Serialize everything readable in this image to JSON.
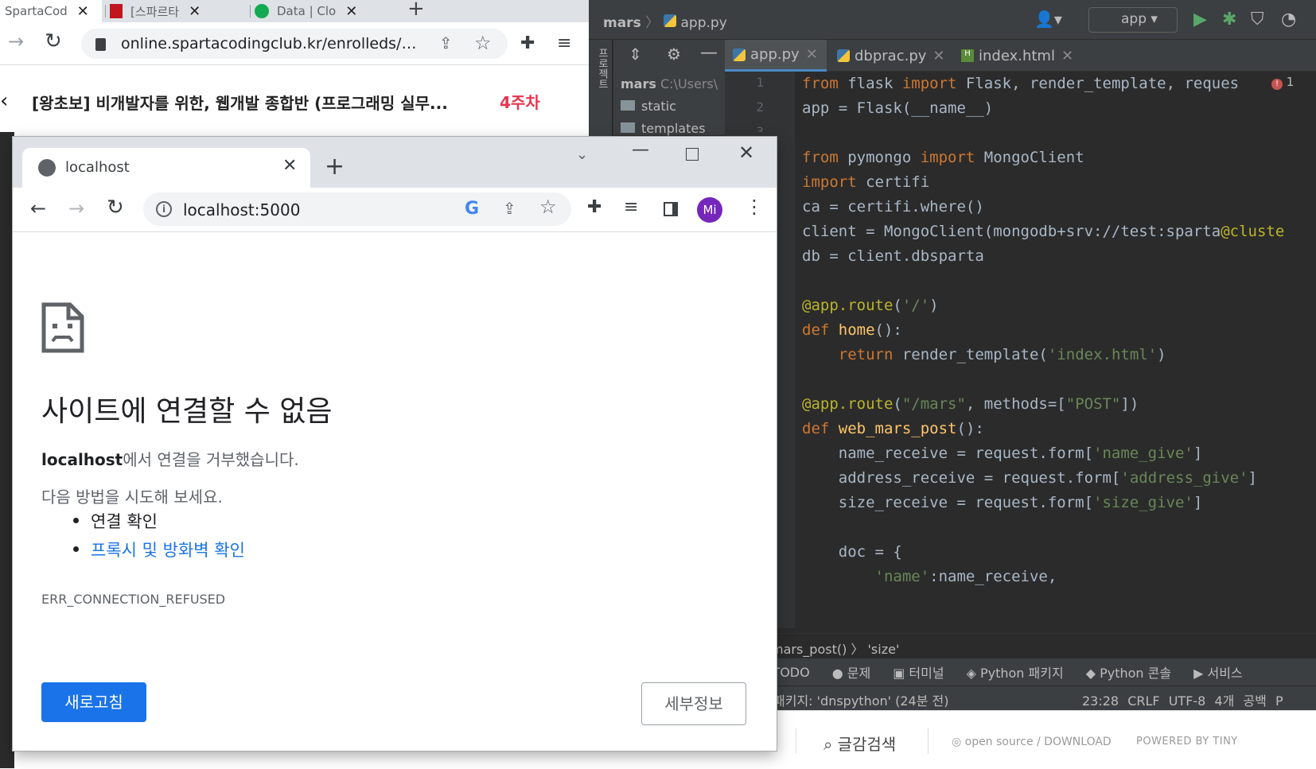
{
  "back_browser": {
    "tabs": [
      {
        "label": "SpartaCod"
      },
      {
        "label": "[스파르타"
      },
      {
        "label": "Data | Clo"
      }
    ],
    "url": "online.spartacodingclub.kr/enrolleds/6...",
    "page_title": "[왕초보] 비개발자를 위한, 웹개발 종합반 (프로그래밍 실무...",
    "week_badge": "4주차",
    "new_tab": "+"
  },
  "ide": {
    "breadcrumb_project": "mars",
    "breadcrumb_file": "app.py",
    "run_config": "app",
    "side_label": "프로젝트",
    "project": {
      "root": "mars",
      "root_path": "C:\\Users\\",
      "folders": [
        "static",
        "templates"
      ]
    },
    "tabs": [
      {
        "label": "app.py"
      },
      {
        "label": "dbprac.py"
      },
      {
        "label": "index.html"
      }
    ],
    "error_count": "1",
    "line_numbers": [
      "1",
      "2",
      "3"
    ],
    "code_lines": [
      "from flask import Flask, render_template, reques",
      "app = Flask(__name__)",
      "",
      "from pymongo import MongoClient",
      "import certifi",
      "ca = certifi.where()",
      "client = MongoClient('mongodb+srv://test:sparta@cluste",
      "db = client.dbsparta",
      "",
      "@app.route('/')",
      "def home():",
      "    return render_template('index.html')",
      "",
      "@app.route(\"/mars\", methods=[\"POST\"])",
      "def web_mars_post():",
      "    name_receive = request.form['name_give']",
      "    address_receive = request.form['address_give']",
      "    size_receive = request.form['size_give']",
      "",
      "    doc = {",
      "        'name':name_receive,"
    ],
    "editor_breadcrumb": "mars_post()  〉 'size'",
    "tool_windows": [
      "TODO",
      "문제",
      "터미널",
      "Python 패키지",
      "Python 콘솔",
      "서비스"
    ],
    "status_message": "패키지: 'dnspython' (24분 전)",
    "status_right": [
      "23:28",
      "CRLF",
      "UTF-8",
      "4개 공백",
      "P"
    ]
  },
  "bottom_bar": {
    "search_label": "글감검색",
    "open_source": "open source / DOWNLOAD",
    "powered_by": "POWERED BY TINY"
  },
  "front_browser": {
    "tab_title": "localhost",
    "url": "localhost:5000",
    "avatar_initials": "Mi",
    "error": {
      "title": "사이트에 연결할 수 없음",
      "desc_host": "localhost",
      "desc_rest": "에서 연결을 거부했습니다.",
      "try_label": "다음 방법을 시도해 보세요.",
      "suggestions": [
        "연결 확인",
        "프록시 및 방화벽 확인"
      ],
      "code": "ERR_CONNECTION_REFUSED"
    },
    "reload_button": "새로고침",
    "details_button": "세부정보"
  },
  "colors": {
    "accent_blue": "#1a73e8",
    "week_red": "#e8344e",
    "ide_bg": "#2b2b2b",
    "avatar": "#7627bb"
  }
}
